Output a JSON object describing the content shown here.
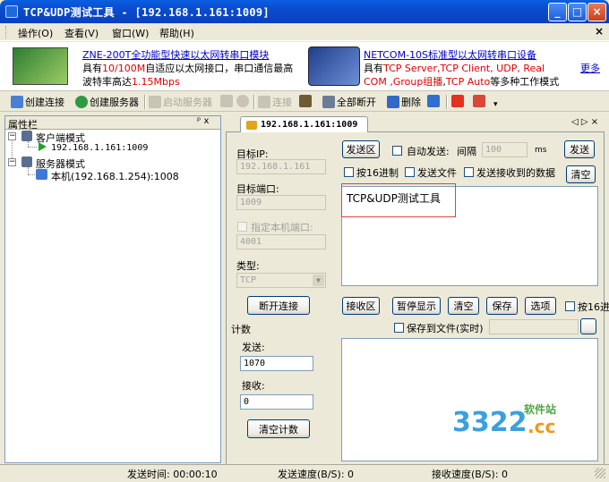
{
  "window": {
    "title": "TCP&UDP测试工具 - [192.168.1.161:1009]"
  },
  "menu": {
    "items": [
      "操作(O)",
      "查看(V)",
      "窗口(W)",
      "帮助(H)"
    ]
  },
  "ads": {
    "ad1_link": "ZNE-200T全功能型快速以太网转串口模块",
    "ad1_line2_pre": "具有",
    "ad1_line2_red": "10/100M",
    "ad1_line2_post": "自适应以太网接口，串口通信最高",
    "ad1_line3_pre": "波特率高达",
    "ad1_line3_red": "1.15Mbps",
    "ad2_link": "NETCOM-10S标准型以太网转串口设备",
    "ad2_line2_pre": "具有",
    "ad2_line2_red": "TCP Server,TCP Client, UDP, Real",
    "ad2_line3_red1": "COM ,Group组播",
    "ad2_line3_mid": ",",
    "ad2_line3_red2": "TCP Auto",
    "ad2_line3_post": "等多种工作模式",
    "more": "更多"
  },
  "toolbar": {
    "create_conn": "创建连接",
    "create_server": "创建服务器",
    "start_server": "启动服务器",
    "connect": "连接",
    "disconnect_all": "全部断开",
    "delete": "删除"
  },
  "left_pane": {
    "header": "属性栏",
    "pin": "ᵖ x",
    "client_mode": "客户端模式",
    "client_item": "192.168.1.161:1009",
    "server_mode": "服务器模式",
    "server_item": "本机(192.168.1.254):1008"
  },
  "tab": {
    "label": "192.168.1.161:1009",
    "nav": "◁ ▷ ×"
  },
  "conn": {
    "target_ip_label": "目标IP:",
    "target_ip": "192.168.1.161",
    "target_port_label": "目标端口:",
    "target_port": "1009",
    "local_port_label": "指定本机端口:",
    "local_port": "4001",
    "type_label": "类型:",
    "type_value": "TCP",
    "disconnect_btn": "断开连接"
  },
  "counts": {
    "title": "计数",
    "send_label": "发送:",
    "send_value": "1070",
    "recv_label": "接收:",
    "recv_value": "0",
    "clear_btn": "清空计数"
  },
  "send": {
    "area_btn": "发送区",
    "auto_send": "自动发送:",
    "interval": "间隔",
    "interval_value": "100",
    "ms": "ms",
    "send_btn": "发送",
    "hex16": "按16进制",
    "send_file": "发送文件",
    "send_recv_data": "发送接收到的数据",
    "clear_btn": "清空",
    "content": "TCP&UDP测试工具"
  },
  "recv": {
    "area_btn": "接收区",
    "pause_btn": "暂停显示",
    "clear_btn": "清空",
    "save_btn": "保存",
    "options_btn": "选项",
    "hex16": "按16进",
    "save_to_file": "保存到文件(实时)"
  },
  "status": {
    "send_time": "发送时间: 00:00:10",
    "send_speed": "发送速度(B/S): 0",
    "recv_speed": "接收速度(B/S): 0"
  },
  "watermark": {
    "num": "3322",
    "cn": "软件站",
    "cc": ".cc"
  }
}
